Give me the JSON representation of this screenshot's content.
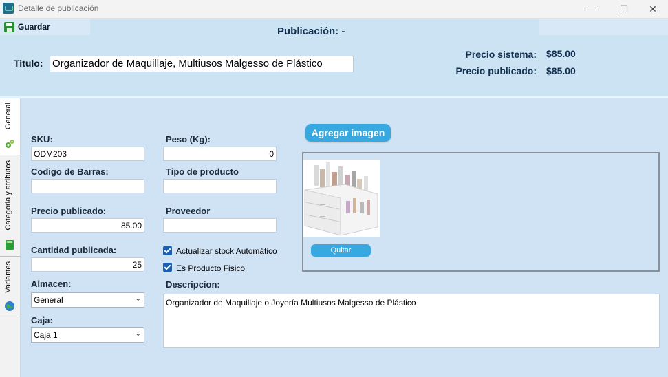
{
  "window": {
    "title": "Detalle de publicación"
  },
  "toolbar": {
    "save_label": "Guardar"
  },
  "header": {
    "publication_label": "Publicación: -",
    "title_label": "Titulo:",
    "title_value": "Organizador de Maquillaje, Multiusos Malgesso de Plástico",
    "price_system_label": "Precio sistema:",
    "price_system_value": "$85.00",
    "price_published_label": "Precio publicado:",
    "price_published_value": "$85.00"
  },
  "tabs": [
    {
      "label": "General",
      "icon": "gears-icon",
      "active": true
    },
    {
      "label": "Categoria y atributos",
      "icon": "book-icon",
      "active": false
    },
    {
      "label": "Variantes",
      "icon": "globe-icon",
      "active": false
    }
  ],
  "form": {
    "sku_label": "SKU:",
    "sku_value": "ODM203",
    "peso_label": "Peso (Kg):",
    "peso_value": "0",
    "barcode_label": "Codigo de Barras:",
    "barcode_value": "",
    "tipo_label": "Tipo de producto",
    "tipo_value": "",
    "precio_label": "Precio publicado:",
    "precio_value": "85.00",
    "proveedor_label": "Proveedor",
    "proveedor_value": "",
    "cantidad_label": "Cantidad publicada:",
    "cantidad_value": "25",
    "stock_auto_label": "Actualizar stock Automático",
    "stock_auto_checked": true,
    "fisico_label": "Es Producto Fisico",
    "fisico_checked": true,
    "almacen_label": "Almacen:",
    "almacen_value": "General",
    "caja_label": "Caja:",
    "caja_value": "Caja 1",
    "descripcion_label": "Descripcion:",
    "descripcion_value": "Organizador de Maquillaje o Joyería Multiusos Malgesso de Plástico"
  },
  "images": {
    "add_label": "Agregar imagen",
    "remove_label": "Quitar"
  },
  "colors": {
    "accent": "#38a8e0",
    "background": "#cfe3f5",
    "header_text": "#12304f",
    "checkbox": "#1a5fb4"
  }
}
